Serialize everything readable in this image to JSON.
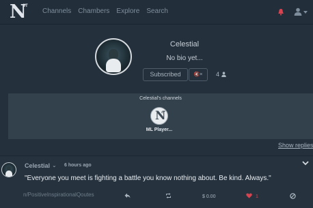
{
  "header": {
    "logo_letter": "N",
    "logo_sup": "ST",
    "nav": [
      "Channels",
      "Chambers",
      "Explore",
      "Search"
    ],
    "accent_color": "#d9434f"
  },
  "profile": {
    "username": "Celestial",
    "bio": "No bio yet...",
    "subscribe_label": "Subscribed",
    "mute_label": "🔇×",
    "subscriber_count": "4"
  },
  "channels": {
    "title": "Celestial's channels",
    "items": [
      {
        "name": "ML Player...",
        "avatar_letter": "N",
        "avatar_sup": "ST"
      }
    ]
  },
  "show_replies_label": "Show replies",
  "post": {
    "author": "Celestial",
    "chevron": "⌄",
    "time": "6 hours ago",
    "text": "\"Everyone you meet is fighting a battle you know nothing about. Be kind. Always.\"",
    "channel": "/PositiveInspirationalQoutes",
    "tip_amount": "$ 0.00",
    "like_count": "1"
  },
  "icons": {
    "bell": "bell-icon",
    "user": "user-icon",
    "reply": "reply-icon",
    "repost": "repost-icon",
    "like": "heart-icon",
    "block": "block-icon"
  }
}
